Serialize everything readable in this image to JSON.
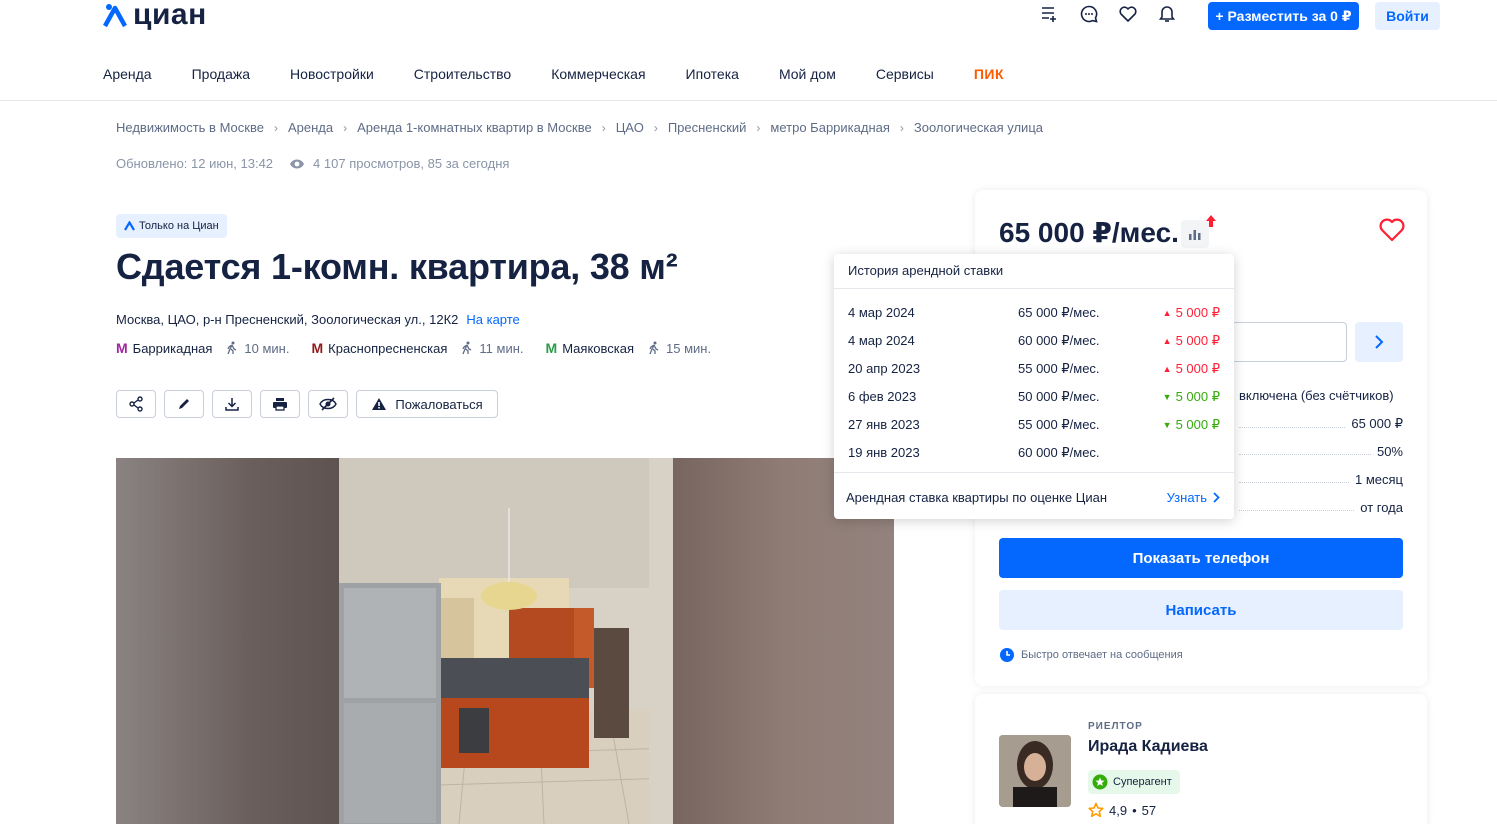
{
  "header": {
    "logo_text": "циан",
    "icons": [
      "compare-list-icon",
      "chat-icon",
      "heart-icon",
      "bell-icon"
    ],
    "post_button": "+ Разместить за 0 ₽",
    "login_button": "Войти"
  },
  "nav": {
    "items": [
      "Аренда",
      "Продажа",
      "Новостройки",
      "Строительство",
      "Коммерческая",
      "Ипотека",
      "Мой дом",
      "Сервисы"
    ],
    "pik": "ПИК"
  },
  "breadcrumbs": [
    "Недвижимость в Москве",
    "Аренда",
    "Аренда 1-комнатных квартир в Москве",
    "ЦАО",
    "Пресненский",
    "метро Баррикадная",
    "Зоологическая улица"
  ],
  "meta": {
    "updated": "Обновлено: 12 июн, 13:42",
    "views": "4 107 просмотров, 85 за сегодня"
  },
  "listing": {
    "badge": "Только на Циан",
    "title": "Сдается 1-комн. квартира, 38 м²",
    "address": "Москва, ЦАО, р-н Пресненский, Зоологическая ул., 12К2",
    "map_link": "На карте",
    "metro": [
      {
        "name": "Баррикадная",
        "time": "10 мин.",
        "color": "#a0269b"
      },
      {
        "name": "Краснопресненская",
        "time": "11 мин.",
        "color": "#8e1b1b"
      },
      {
        "name": "Маяковская",
        "time": "15 мин.",
        "color": "#2a9d4a"
      }
    ],
    "complain": "Пожаловаться"
  },
  "price_card": {
    "price": "65 000 ₽/мес.",
    "utilities": "включена (без счётчиков)",
    "rows": [
      "65 000 ₽",
      "50%",
      "1 месяц",
      "от года"
    ],
    "phone_button": "Показать телефон",
    "write_button": "Написать",
    "fast_reply": "Быстро отвечает на сообщения"
  },
  "agent": {
    "role": "РИЕЛТОР",
    "name": "Ирада Кадиева",
    "badge": "Суперагент",
    "rating": "4,9",
    "reviews": "57"
  },
  "popup": {
    "title": "История арендной ставки",
    "history": [
      {
        "date": "4 мар 2024",
        "value": "65 000 ₽/мес.",
        "delta": "5 000 ₽",
        "dir": "up"
      },
      {
        "date": "4 мар 2024",
        "value": "60 000 ₽/мес.",
        "delta": "5 000 ₽",
        "dir": "up"
      },
      {
        "date": "20 апр 2023",
        "value": "55 000 ₽/мес.",
        "delta": "5 000 ₽",
        "dir": "up"
      },
      {
        "date": "6 фев 2023",
        "value": "50 000 ₽/мес.",
        "delta": "5 000 ₽",
        "dir": "down"
      },
      {
        "date": "27 янв 2023",
        "value": "55 000 ₽/мес.",
        "delta": "5 000 ₽",
        "dir": "down"
      },
      {
        "date": "19 янв 2023",
        "value": "60 000 ₽/мес.",
        "delta": "",
        "dir": ""
      }
    ],
    "footer": "Арендная ставка квартиры по оценке Циан",
    "link": "Узнать"
  }
}
